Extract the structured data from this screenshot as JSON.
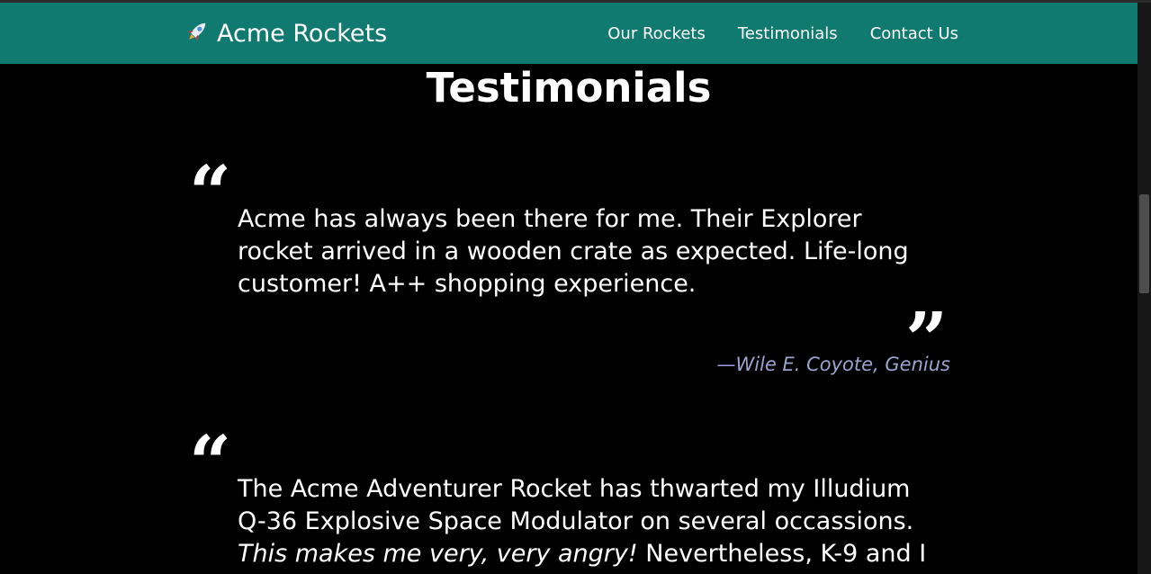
{
  "navbar": {
    "brand_icon": "rocket-icon",
    "brand_label": "Acme Rockets",
    "links": [
      "Our Rockets",
      "Testimonials",
      "Contact Us"
    ]
  },
  "page": {
    "title": "Testimonials"
  },
  "testimonials": [
    {
      "text": "Acme has always been there for me. Their Explorer rocket arrived in a wooden crate as expected. Life-long customer! A++ shopping experience.",
      "attribution": "—Wile E. Coyote, Genius"
    },
    {
      "text_before": "The Acme Adventurer Rocket has thwarted my Illudium Q-36 Explosive Space Modulator on several occassions.",
      "text_emphasis": "This makes me very, very angry!",
      "text_after": "Nevertheless, K-9 and I"
    }
  ],
  "colors": {
    "navbar": "#117a70",
    "background": "#000000",
    "attribution": "#9aa4cf"
  }
}
